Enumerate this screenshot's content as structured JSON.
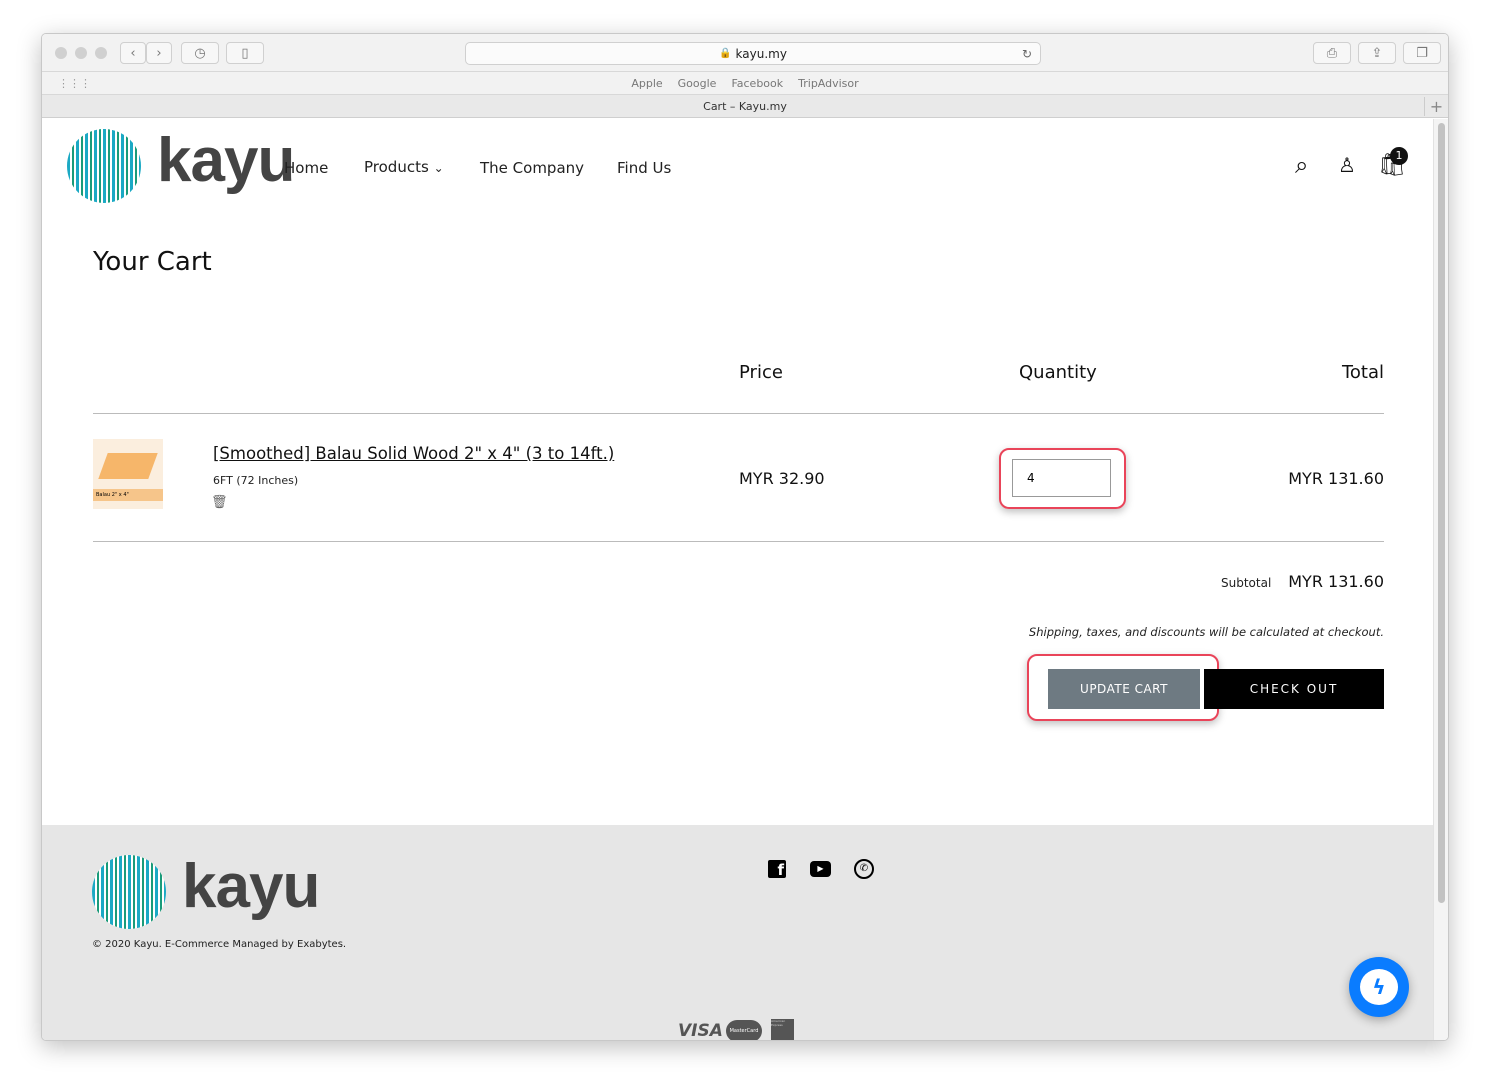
{
  "browser": {
    "url": "kayu.my",
    "bookmarks": [
      "Apple",
      "Google",
      "Facebook",
      "TripAdvisor"
    ],
    "tab_title": "Cart – Kayu.my"
  },
  "header": {
    "logo": "kayu",
    "nav": [
      "Home",
      "Products",
      "The Company",
      "Find Us"
    ],
    "cart_count": "1"
  },
  "cart": {
    "title": "Your Cart",
    "columns": {
      "price": "Price",
      "quantity": "Quantity",
      "total": "Total"
    },
    "item": {
      "name": "[Smoothed] Balau Solid Wood 2\" x 4\" (3 to 14ft.)",
      "variant": "6FT (72 Inches)",
      "price": "MYR 32.90",
      "quantity": "4",
      "total": "MYR 131.60",
      "image_label": "Balau 2\" x 4\""
    },
    "subtotal_label": "Subtotal",
    "subtotal": "MYR 131.60",
    "note": "Shipping, taxes, and discounts will be calculated at checkout.",
    "update_label": "UPDATE CART",
    "checkout_label": "CHECK OUT"
  },
  "footer": {
    "logo": "kayu",
    "copyright": "© 2020 Kayu. E-Commerce Managed by Exabytes.",
    "payments": [
      "VISA",
      "MasterCard",
      "American Express"
    ]
  },
  "colors": {
    "highlight": "#e94459",
    "messenger": "#0a7cff",
    "update_btn": "#6e7a82"
  }
}
